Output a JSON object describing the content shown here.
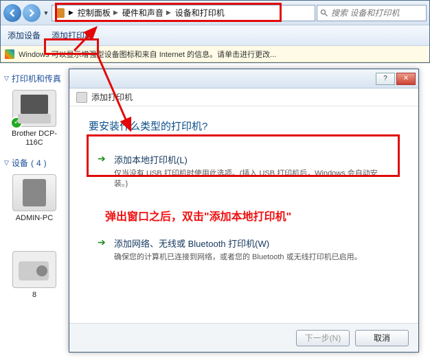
{
  "nav": {
    "breadcrumb": {
      "root_icon_name": "control-panel-icon",
      "parts": [
        "控制面板",
        "硬件和声音",
        "设备和打印机"
      ]
    },
    "search_placeholder": "搜索 设备和打印机"
  },
  "toolbar": {
    "add_device": "添加设备",
    "add_printer": "添加打印机"
  },
  "infobar": {
    "text": "Windows 可以显示增强型设备图标和来自 Internet 的信息。请单击进行更改..."
  },
  "categories": {
    "printers": {
      "label": "打印机和传真",
      "count": null
    },
    "devices": {
      "label": "设备",
      "count": 4
    }
  },
  "devices": {
    "printer": {
      "name": "Brother DCP-116C",
      "status_ok": true
    },
    "pc": {
      "name": "ADMIN-PC"
    },
    "camera": {
      "name": "8"
    }
  },
  "dialog": {
    "title": "添加打印机",
    "heading": "要安装什么类型的打印机?",
    "options": [
      {
        "title": "添加本地打印机(L)",
        "desc": "仅当没有 USB 打印机时使用此选项。(插入 USB 打印机后，Windows 会自动安装。)"
      },
      {
        "title": "添加网络、无线或 Bluetooth 打印机(W)",
        "desc": "确保您的计算机已连接到网络，或者您的 Bluetooth 或无线打印机已启用。"
      }
    ],
    "annotation": "弹出窗口之后，双击\"添加本地打印机\"",
    "buttons": {
      "next": "下一步(N)",
      "cancel": "取消"
    },
    "winbtn": {
      "close": "✕",
      "help": "?"
    }
  }
}
